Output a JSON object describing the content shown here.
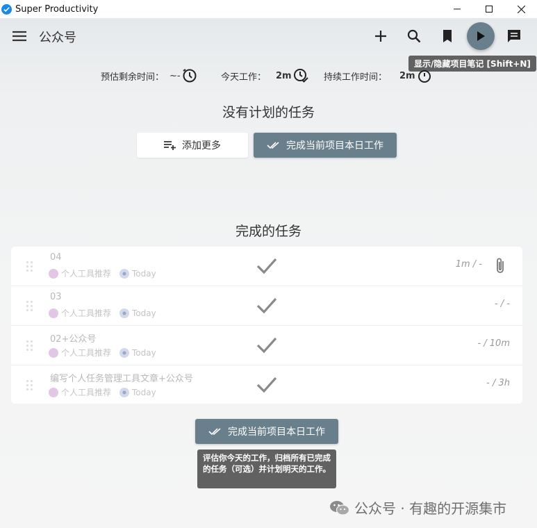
{
  "window": {
    "title": "Super Productivity"
  },
  "header": {
    "title": "公众号",
    "notes_tooltip": "显示/隐藏项目笔记 [Shift+N]"
  },
  "stats": {
    "estimate_label": "预估剩余时间：",
    "estimate_value": "~-",
    "today_label": "今天工作：",
    "today_value": "2m",
    "session_label": "持续工作时间：",
    "session_value": "2m"
  },
  "planned": {
    "title": "没有计划的任务",
    "add_more_label": "添加更多",
    "finish_day_label": "完成当前项目本日工作"
  },
  "done": {
    "title": "完成的任务",
    "tasks": [
      {
        "title": "04",
        "project": "个人工具推荐",
        "tag": "Today",
        "time": "1m / -",
        "has_attachment": true
      },
      {
        "title": "03",
        "project": "个人工具推荐",
        "tag": "Today",
        "time": "- / -",
        "has_attachment": false
      },
      {
        "title": "02+公众号",
        "project": "个人工具推荐",
        "tag": "Today",
        "time": "- / 10m",
        "has_attachment": false
      },
      {
        "title": "编写个人任务管理工具文章+公众号",
        "project": "个人工具推荐",
        "tag": "Today",
        "time": "- / 3h",
        "has_attachment": false
      }
    ],
    "finish_day_label": "完成当前项目本日工作",
    "finish_tooltip": "评估你今天的工作，归档所有已完成的任务（可选）并计划明天的工作。"
  },
  "watermark": {
    "text": "公众号 · 有趣的开源集市"
  },
  "colors": {
    "accent": "#6a7f8c",
    "logo": "#1e88e5",
    "tooltip": "#616161"
  },
  "icons": [
    "app-logo-icon",
    "minimize-icon",
    "maximize-icon",
    "close-icon",
    "menu-icon",
    "add-icon",
    "search-icon",
    "bookmark-icon",
    "play-icon",
    "chat-icon",
    "clock-icon",
    "add-list-icon",
    "done-all-icon",
    "check-icon",
    "attachment-icon",
    "drag-handle-icon",
    "wechat-icon"
  ]
}
